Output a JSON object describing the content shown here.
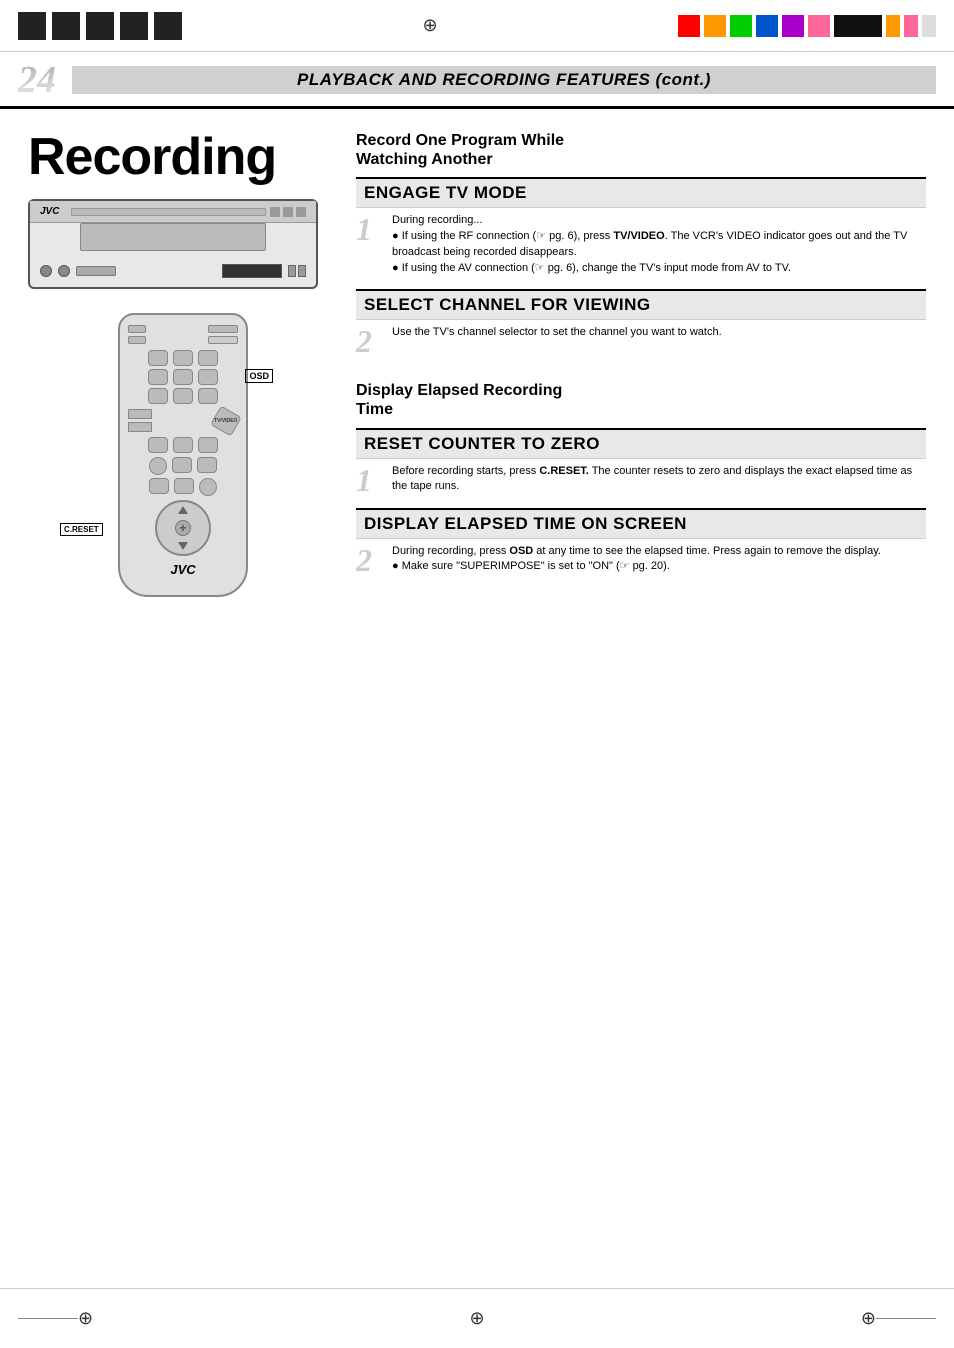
{
  "topBar": {
    "colorBlocks": [
      "#ff0000",
      "#ff9900",
      "#00cc00",
      "#0055cc",
      "#aa00cc",
      "#ff6699"
    ],
    "crosshair": "⊕"
  },
  "pageHeader": {
    "pageNumber": "24",
    "title": "PLAYBACK AND RECORDING FEATURES (cont.)"
  },
  "leftColumn": {
    "sectionTitle": "Recording",
    "vcrBrand": "JVC"
  },
  "remote": {
    "osdLabel": "OSD",
    "cresetLabel": "C.RESET",
    "brand": "JVC"
  },
  "rightColumn": {
    "section1": {
      "heading": "Record One Program While\nWatching Another",
      "step1": {
        "title": "ENGAGE TV MODE",
        "stepNum": "1",
        "intro": "During recording...",
        "bullet1": "If using the RF connection (☞ pg. 6), press TV/VIDEO. The VCR's VIDEO indicator goes out and the TV broadcast being recorded disappears.",
        "bullet2": "If using the AV connection (☞ pg. 6), change the TV's input mode from AV to TV."
      },
      "step2": {
        "title": "SELECT CHANNEL FOR VIEWING",
        "stepNum": "2",
        "text": "Use the TV's channel selector to set the channel you want to watch."
      }
    },
    "section2": {
      "heading": "Display Elapsed Recording\nTime",
      "step1": {
        "title": "RESET COUNTER TO ZERO",
        "stepNum": "1",
        "text": "Before recording starts, press C.RESET. The counter resets to zero and displays the exact elapsed time as the tape runs."
      },
      "step2": {
        "title": "DISPLAY ELAPSED TIME ON SCREEN",
        "stepNum": "2",
        "text": "During recording, press OSD at any time to see the elapsed time. Press again to remove the display.",
        "bullet": "Make sure \"SUPERIMPOSE\" is set to \"ON\" (☞ pg. 20)."
      }
    }
  },
  "bottomBar": {
    "crosshair": "⊕"
  }
}
